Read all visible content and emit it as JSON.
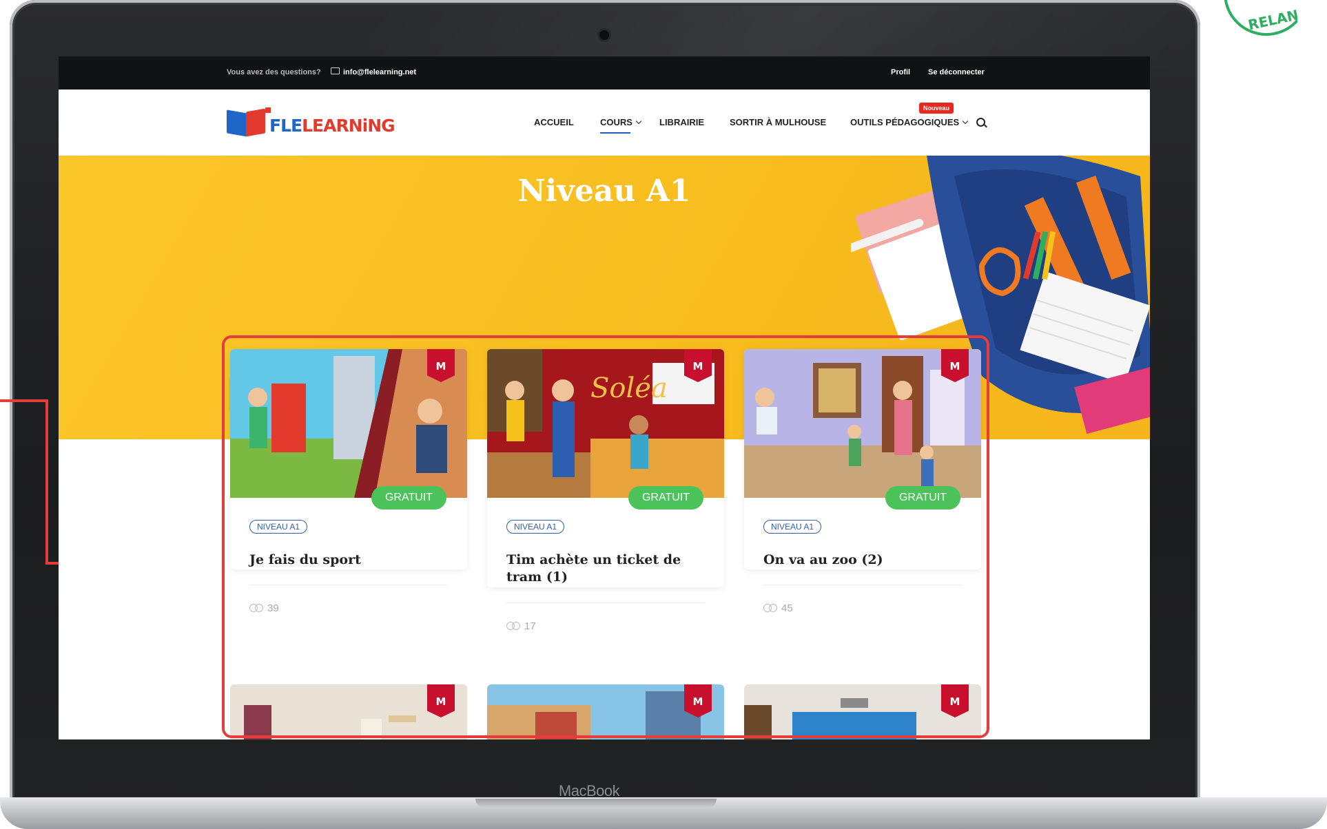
{
  "device": {
    "label": "MacBook"
  },
  "seal": {
    "text": "RELANCE"
  },
  "topbar": {
    "question": "Vous avez des questions?",
    "email": "info@flelearning.net",
    "profile": "Profil",
    "logout": "Se déconnecter"
  },
  "logo": {
    "part1": "FLE",
    "part2": "LEARNiNG"
  },
  "nav": {
    "accueil": "ACCUEIL",
    "cours": "COURS",
    "librairie": "LIBRAIRIE",
    "sortir": "SORTIR À MULHOUSE",
    "outils": "OUTILS PÉDAGOGIQUES",
    "badge": "Nouveau"
  },
  "hero": {
    "title": "Niveau A1"
  },
  "cards": [
    {
      "title": "Je fais du sport",
      "level": "NIVEAU A1",
      "price": "GRATUIT",
      "students": "39",
      "ribbon": "M"
    },
    {
      "title": "Tim achète un ticket de tram (1)",
      "level": "NIVEAU A1",
      "price": "GRATUIT",
      "students": "17",
      "ribbon": "M"
    },
    {
      "title": "On va au zoo (2)",
      "level": "NIVEAU A1",
      "price": "GRATUIT",
      "students": "45",
      "ribbon": "M"
    }
  ],
  "row2_ribbon": "M",
  "colors": {
    "accent_red": "#e63c3c",
    "brand_blue": "#1f66c9",
    "hero_yellow": "#f8bd1f",
    "badge_green": "#4cc25a"
  }
}
